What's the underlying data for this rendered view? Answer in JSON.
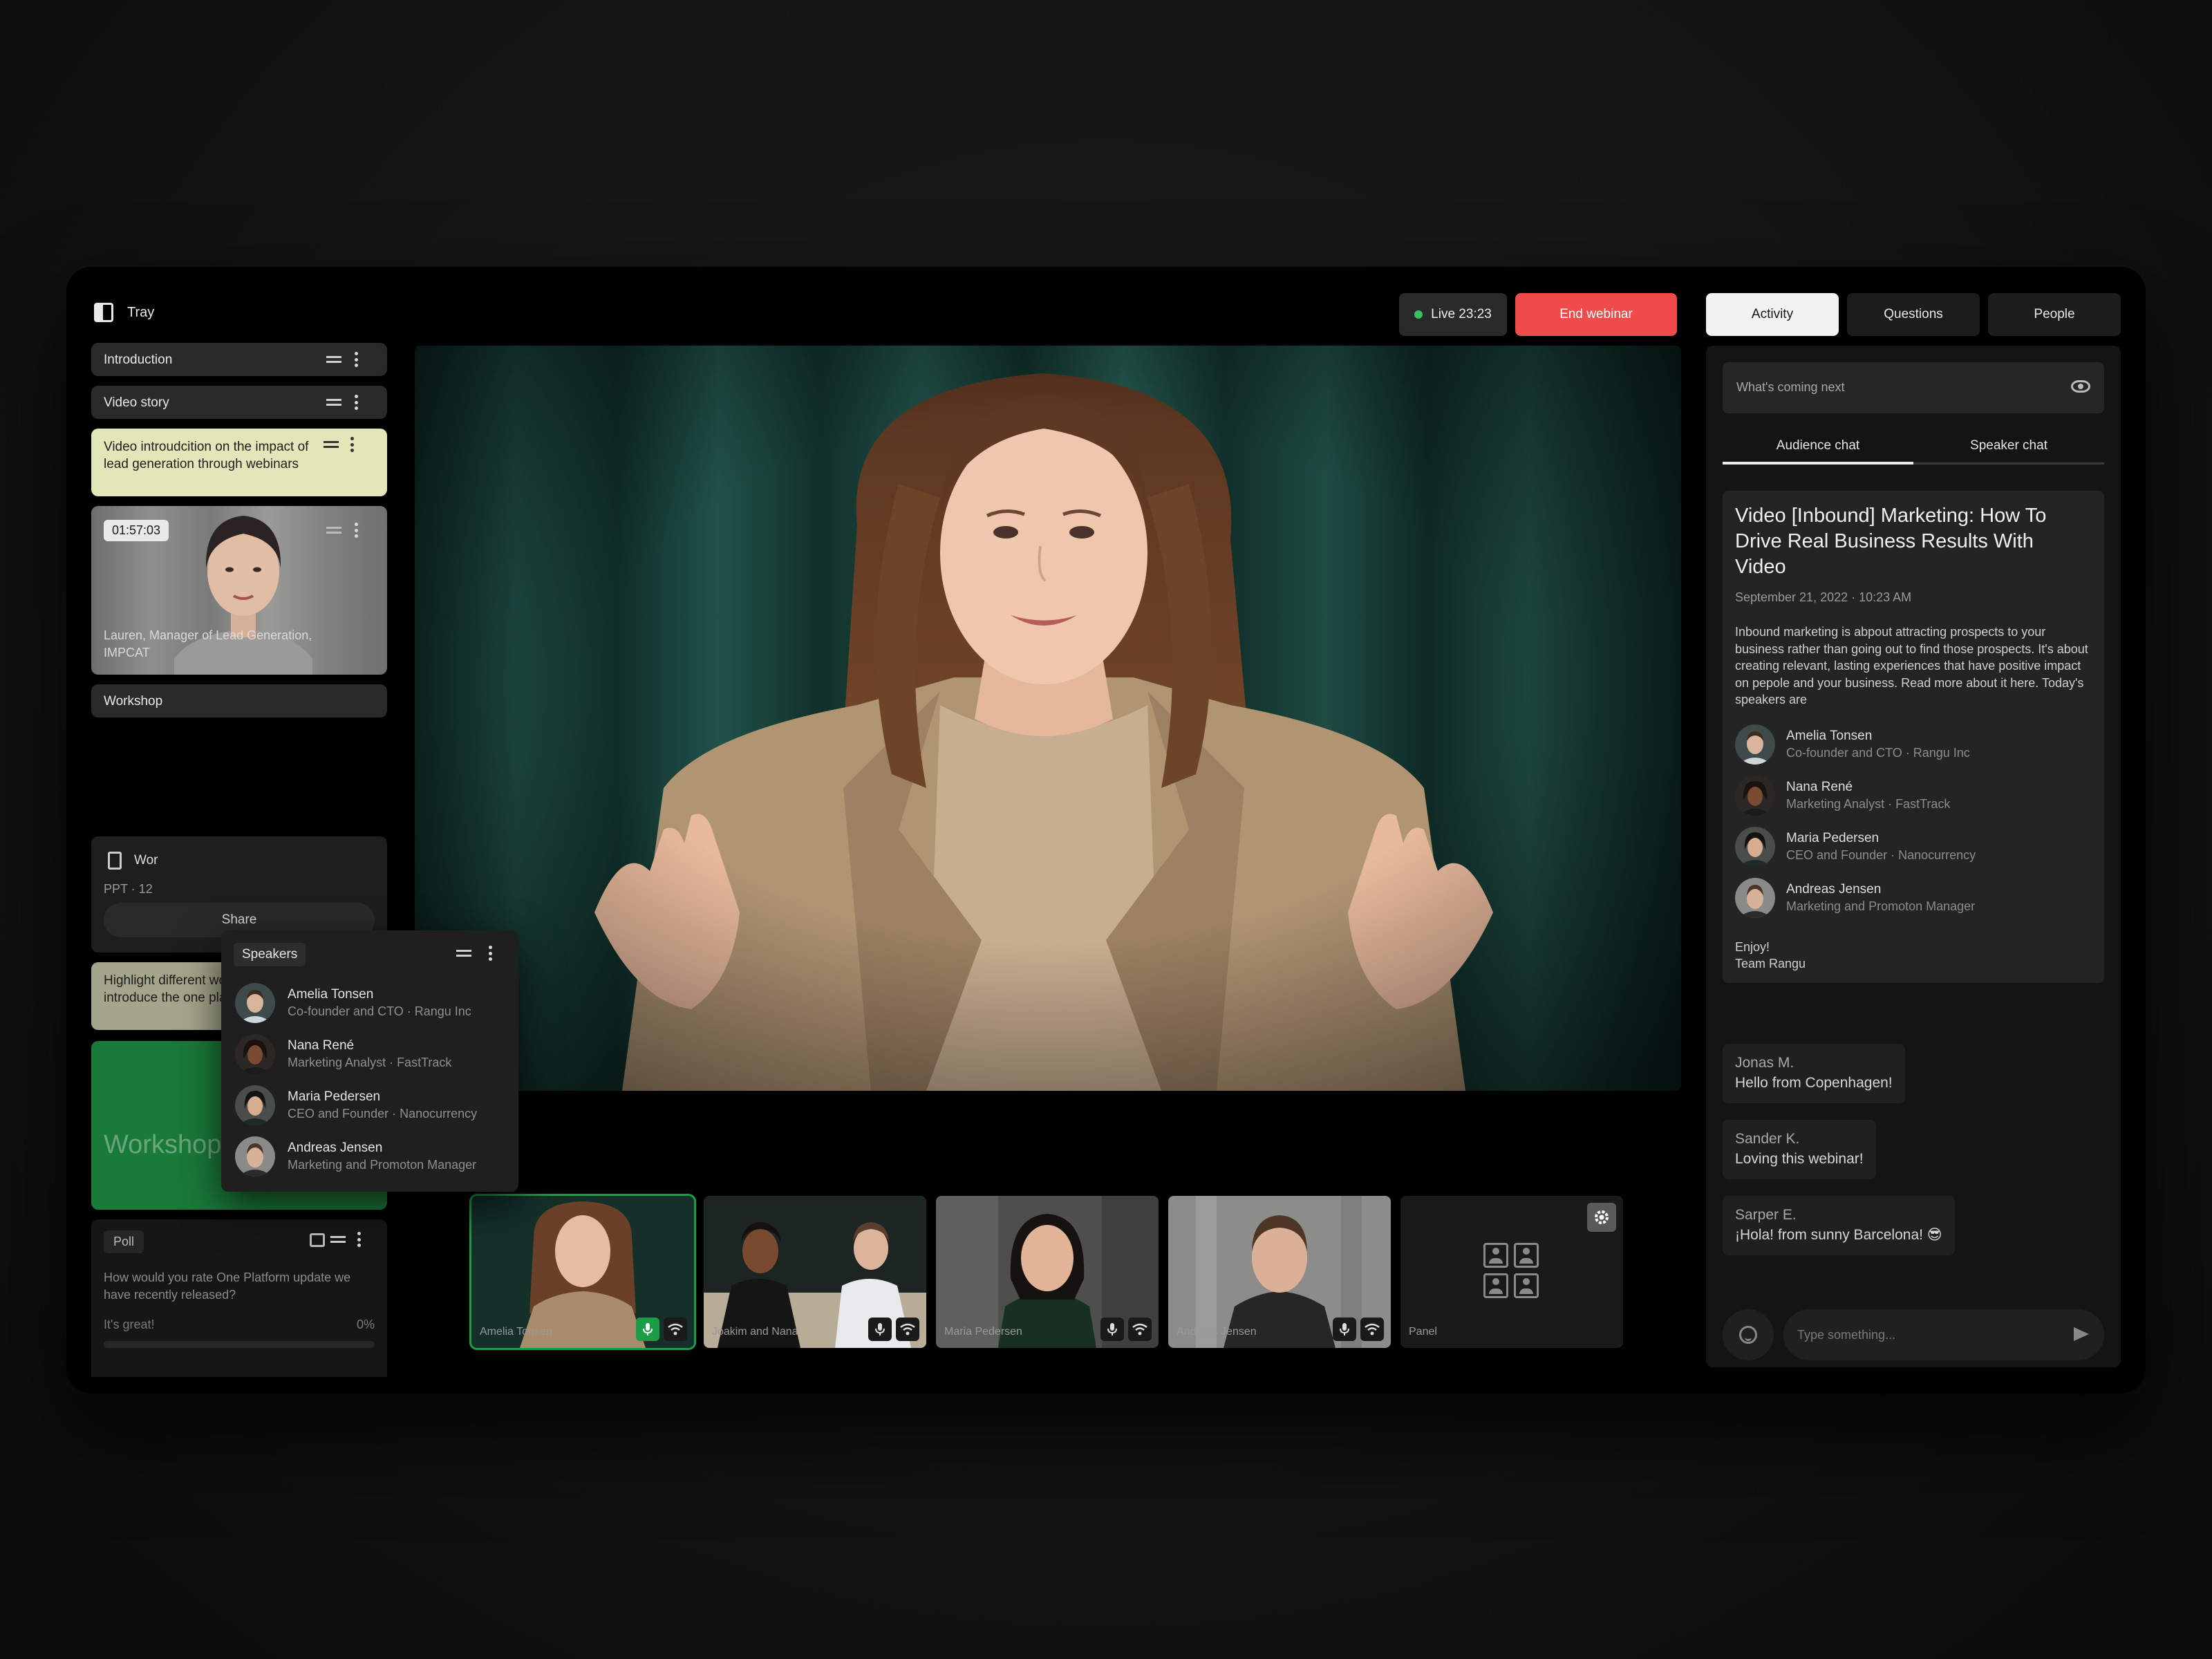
{
  "tray": {
    "title": "Tray"
  },
  "agenda": {
    "items": [
      {
        "label": "Introduction"
      },
      {
        "label": "Video story"
      },
      {
        "label": "Video introudcition on the impact of lead generation through webinars"
      },
      {
        "label": "Workshop"
      },
      {
        "label": "Highlight different workshop teams and introduce the one platform before poll."
      }
    ],
    "video": {
      "timecode": "01:57:03",
      "caption": "Lauren, Manager of Lead Generation, IMPCAT"
    },
    "file": {
      "name": "Wor",
      "meta": "PPT · 12",
      "share_label": "Share"
    },
    "workshop_card": {
      "title": "Workshop Introduction"
    },
    "poll": {
      "tag": "Poll",
      "question": "How would you rate One Platform update we have recently released?",
      "option": "It's great!",
      "percent": "0%",
      "fill": 0
    }
  },
  "speakers_popup": {
    "tag": "Speakers"
  },
  "speakers": [
    {
      "name": "Amelia Tonsen",
      "role": "Co-founder and CTO · Rangu Inc"
    },
    {
      "name": "Nana René",
      "role": "Marketing Analyst · FastTrack"
    },
    {
      "name": "Maria Pedersen",
      "role": "CEO and Founder · Nanocurrency"
    },
    {
      "name": "Andreas Jensen",
      "role": "Marketing and Promoton Manager"
    }
  ],
  "top": {
    "live_label": "Live 23:23",
    "end_label": "End webinar",
    "live_color": "#36c25d",
    "end_color": "#f04b4b"
  },
  "participants": [
    {
      "name": "Amelia Tonsen",
      "active": true
    },
    {
      "name": "Joakim and Nana",
      "active": false
    },
    {
      "name": "Maria Pedersen",
      "active": false
    },
    {
      "name": "Andreas Jensen",
      "active": false
    },
    {
      "name": "Panel",
      "active": false
    }
  ],
  "right": {
    "tabs": [
      {
        "label": "Activity"
      },
      {
        "label": "Questions"
      },
      {
        "label": "People"
      }
    ],
    "whats_next": "What's coming next",
    "chat_tabs": [
      {
        "label": "Audience chat"
      },
      {
        "label": "Speaker chat"
      }
    ],
    "info": {
      "title": "Video [Inbound] Marketing: How To Drive Real Business Results With Video",
      "date": "September 21, 2022 · 10:23 AM",
      "description": "Inbound marketing is abpout attracting prospects to your business rather than going out to find those prospects. It's about creating relevant, lasting experiences that have positive impact on pepole and your business. Read more about it here. Today's speakers are",
      "outro_1": "Enjoy!",
      "outro_2": "Team Rangu"
    },
    "messages": [
      {
        "name": "Jonas M.",
        "text": "Hello from Copenhagen!"
      },
      {
        "name": "Sander K.",
        "text": "Loving this webinar!"
      },
      {
        "name": "Sarper E.",
        "text": "¡Hola! from sunny Barcelona! 😎"
      }
    ],
    "input_placeholder": "Type something..."
  }
}
